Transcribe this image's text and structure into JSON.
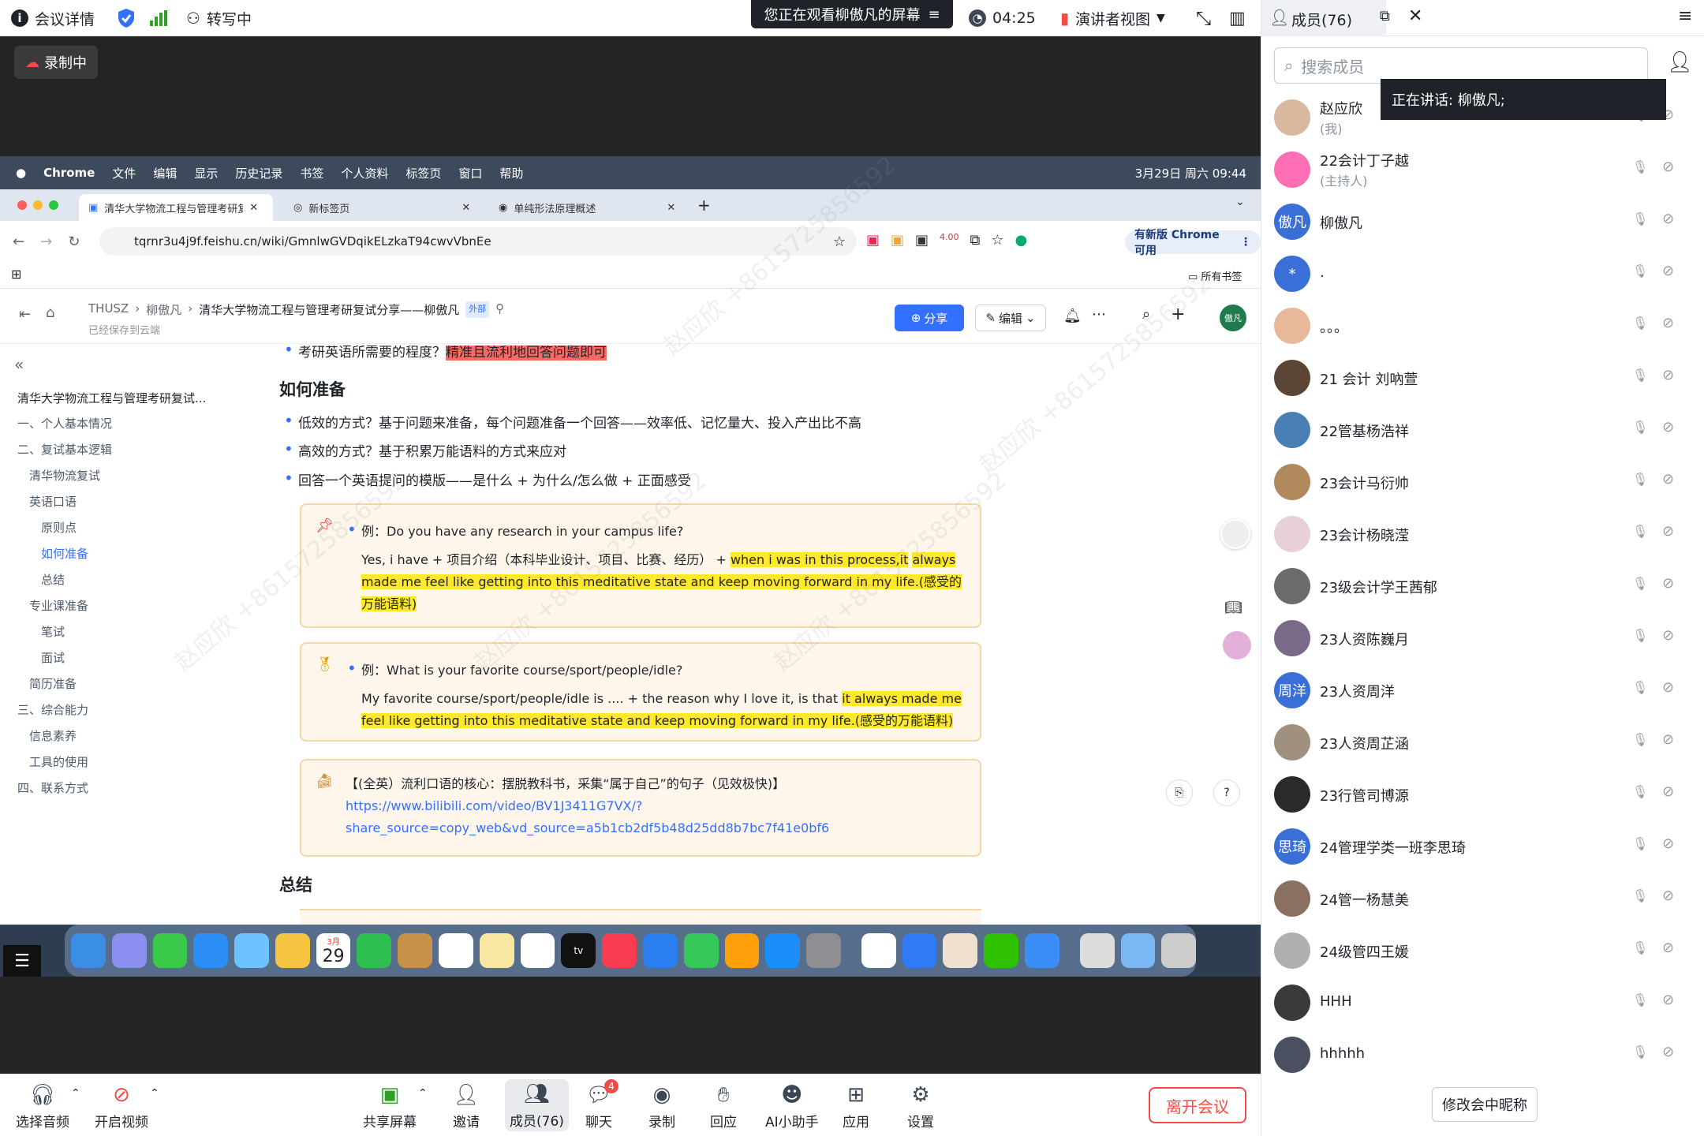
{
  "topbar": {
    "meeting_info": "会议详情",
    "transcribe": "转写中",
    "banner": "您正在观看柳傲凡的屏幕",
    "timer": "04:25",
    "presenter_view": "演讲者视图",
    "members_tab": "成员(76)"
  },
  "recording_badge": "录制中",
  "mac_menu": [
    "Chrome",
    "文件",
    "编辑",
    "显示",
    "历史记录",
    "书签",
    "个人资料",
    "标签页",
    "窗口",
    "帮助"
  ],
  "mac_clock": "3月29日 周六 09:44",
  "browser": {
    "tabs": [
      "清华大学物流工程与管理考研复试",
      "新标签页",
      "单纯形法原理概述"
    ],
    "url": "tqrnr3u4j9f.feishu.cn/wiki/GmnlwGVDqikELzkaT94cwvVbnEe",
    "update_button": "有新版 Chrome 可用",
    "all_bookmarks": "所有书签",
    "ext_badge": "4.00"
  },
  "doc_header": {
    "crumbs": [
      "THUSZ",
      "柳傲凡",
      "清华大学物流工程与管理考研复试分享——柳傲凡"
    ],
    "external_tag": "外部",
    "saved": "已经保存到云端",
    "share": "分享",
    "edit": "编辑",
    "avatar": "傲凡"
  },
  "toc": {
    "title": "清华大学物流工程与管理考研复试...",
    "items": [
      "一、个人基本情况",
      "二、复试基本逻辑",
      "清华物流复试",
      "英语口语",
      "原则点",
      "如何准备",
      "总结",
      "专业课准备",
      "笔试",
      "面试",
      "简历准备",
      "三、综合能力",
      "信息素养",
      "工具的使用",
      "四、联系方式"
    ]
  },
  "doc": {
    "top_partial_prefix": "考研英语所需要的程度？",
    "top_partial_hl": "精准且流利地回答问题即可",
    "heading1": "如何准备",
    "bullets": [
      "低效的方式？基于问题来准备，每个问题准备一个回答——效率低、记忆量大、投入产出比不高",
      "高效的方式？基于积累万能语料的方式来应对",
      "回答一个英语提问的模版——是什么 + 为什么/怎么做 + 正面感受"
    ],
    "callout1_q": "例：Do you have any research in your campus life?",
    "callout1_a_plain": "Yes, i have + 项目介绍（本科毕业设计、项目、比赛、经历） + ",
    "callout1_a_hl1": "when i was in this process,it",
    "callout1_a_hl2": "always made me feel like getting into this meditative state and keep moving forward in my life.(感",
    "callout1_a_hl3": "受的万能语料)",
    "callout2_q": "例：What is your favorite course/sport/people/idle?",
    "callout2_a_plain": "My favorite course/sport/people/idle is .... + the reason why I love it, is that ",
    "callout2_a_hl1": "it always made me",
    "callout2_a_hl2": "feel like getting into this meditative state and keep moving forward in my life.(感受的万能语料)",
    "callout3_title": "【(全英）流利口语的核心：摆脱教科书，采集“属于自己”的句子（见效极快)】",
    "callout3_link1": "https://www.bilibili.com/video/BV1J3411G7VX/?",
    "callout3_link2": "share_source=copy_web&vd_source=a5b1cb2df5b48d25dd8b7bc7f41e0bf6",
    "heading2": "总结"
  },
  "dock_date": "29",
  "dock_month": "3月",
  "side": {
    "search_placeholder": "搜索成员",
    "speaking": "正在讲话:   柳傲凡;",
    "members": [
      {
        "name": "赵应欣",
        "sub": "(我)",
        "avatar": "",
        "color": "#d9b8a0"
      },
      {
        "name": "22会计丁子越",
        "sub": "(主持人)",
        "avatar": "",
        "color": "#ff6fb5"
      },
      {
        "name": "柳傲凡",
        "sub": "",
        "avatar": "傲凡",
        "color": "#3a6fd8"
      },
      {
        "name": ".",
        "sub": "",
        "avatar": "*",
        "color": "#3a6fd8"
      },
      {
        "name": "。。。",
        "sub": "",
        "avatar": "",
        "color": "#e8b89a"
      },
      {
        "name": "21 会计 刘吶萱",
        "sub": "",
        "avatar": "",
        "color": "#5b4636"
      },
      {
        "name": "22管基杨浩祥",
        "sub": "",
        "avatar": "",
        "color": "#4a7fb5"
      },
      {
        "name": "23会计马衍帅",
        "sub": "",
        "avatar": "",
        "color": "#b08a5c"
      },
      {
        "name": "23会计杨晓滢",
        "sub": "",
        "avatar": "",
        "color": "#e8d0d8"
      },
      {
        "name": "23级会计学王茜郁",
        "sub": "",
        "avatar": "",
        "color": "#6b6b6b"
      },
      {
        "name": "23人资陈巍月",
        "sub": "",
        "avatar": "",
        "color": "#7a6a8a"
      },
      {
        "name": "23人资周洋",
        "sub": "",
        "avatar": "周洋",
        "color": "#3a6fd8"
      },
      {
        "name": "23人资周芷涵",
        "sub": "",
        "avatar": "",
        "color": "#a09080"
      },
      {
        "name": "23行管司博源",
        "sub": "",
        "avatar": "",
        "color": "#2a2a2a"
      },
      {
        "name": "24管理学类一班李思琦",
        "sub": "",
        "avatar": "思琦",
        "color": "#3a6fd8"
      },
      {
        "name": "24管一杨慧美",
        "sub": "",
        "avatar": "",
        "color": "#8a7060"
      },
      {
        "name": "24级管四王媛",
        "sub": "",
        "avatar": "",
        "color": "#b0b0b0"
      },
      {
        "name": "HHH",
        "sub": "",
        "avatar": "",
        "color": "#3a3a3a"
      },
      {
        "name": "hhhhh",
        "sub": "",
        "avatar": "",
        "color": "#4a5060"
      }
    ],
    "rename_button": "修改会中昵称"
  },
  "bottombar": {
    "audio": "选择音频",
    "video": "开启视频",
    "share": "共享屏幕",
    "invite": "邀请",
    "members": "成员(76)",
    "chat": "聊天",
    "chat_badge": "4",
    "record": "录制",
    "react": "回应",
    "ai": "AI小助手",
    "apps": "应用",
    "settings": "设置",
    "leave": "离开会议"
  },
  "colors": {
    "accent": "#3370ff",
    "leave": "#f54a45",
    "highlight": "#ffe928"
  }
}
